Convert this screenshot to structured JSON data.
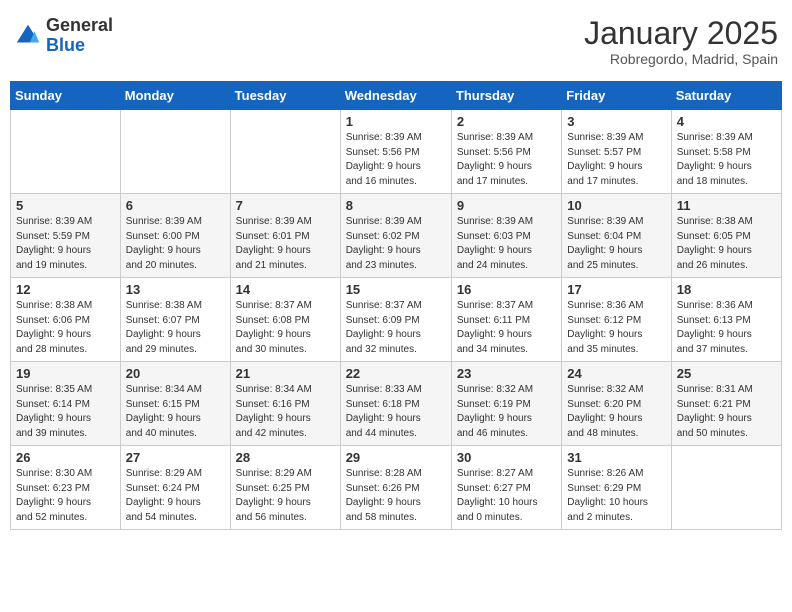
{
  "header": {
    "logo_general": "General",
    "logo_blue": "Blue",
    "month_title": "January 2025",
    "location": "Robregordo, Madrid, Spain"
  },
  "weekdays": [
    "Sunday",
    "Monday",
    "Tuesday",
    "Wednesday",
    "Thursday",
    "Friday",
    "Saturday"
  ],
  "weeks": [
    [
      {
        "day": "",
        "info": ""
      },
      {
        "day": "",
        "info": ""
      },
      {
        "day": "",
        "info": ""
      },
      {
        "day": "1",
        "info": "Sunrise: 8:39 AM\nSunset: 5:56 PM\nDaylight: 9 hours\nand 16 minutes."
      },
      {
        "day": "2",
        "info": "Sunrise: 8:39 AM\nSunset: 5:56 PM\nDaylight: 9 hours\nand 17 minutes."
      },
      {
        "day": "3",
        "info": "Sunrise: 8:39 AM\nSunset: 5:57 PM\nDaylight: 9 hours\nand 17 minutes."
      },
      {
        "day": "4",
        "info": "Sunrise: 8:39 AM\nSunset: 5:58 PM\nDaylight: 9 hours\nand 18 minutes."
      }
    ],
    [
      {
        "day": "5",
        "info": "Sunrise: 8:39 AM\nSunset: 5:59 PM\nDaylight: 9 hours\nand 19 minutes."
      },
      {
        "day": "6",
        "info": "Sunrise: 8:39 AM\nSunset: 6:00 PM\nDaylight: 9 hours\nand 20 minutes."
      },
      {
        "day": "7",
        "info": "Sunrise: 8:39 AM\nSunset: 6:01 PM\nDaylight: 9 hours\nand 21 minutes."
      },
      {
        "day": "8",
        "info": "Sunrise: 8:39 AM\nSunset: 6:02 PM\nDaylight: 9 hours\nand 23 minutes."
      },
      {
        "day": "9",
        "info": "Sunrise: 8:39 AM\nSunset: 6:03 PM\nDaylight: 9 hours\nand 24 minutes."
      },
      {
        "day": "10",
        "info": "Sunrise: 8:39 AM\nSunset: 6:04 PM\nDaylight: 9 hours\nand 25 minutes."
      },
      {
        "day": "11",
        "info": "Sunrise: 8:38 AM\nSunset: 6:05 PM\nDaylight: 9 hours\nand 26 minutes."
      }
    ],
    [
      {
        "day": "12",
        "info": "Sunrise: 8:38 AM\nSunset: 6:06 PM\nDaylight: 9 hours\nand 28 minutes."
      },
      {
        "day": "13",
        "info": "Sunrise: 8:38 AM\nSunset: 6:07 PM\nDaylight: 9 hours\nand 29 minutes."
      },
      {
        "day": "14",
        "info": "Sunrise: 8:37 AM\nSunset: 6:08 PM\nDaylight: 9 hours\nand 30 minutes."
      },
      {
        "day": "15",
        "info": "Sunrise: 8:37 AM\nSunset: 6:09 PM\nDaylight: 9 hours\nand 32 minutes."
      },
      {
        "day": "16",
        "info": "Sunrise: 8:37 AM\nSunset: 6:11 PM\nDaylight: 9 hours\nand 34 minutes."
      },
      {
        "day": "17",
        "info": "Sunrise: 8:36 AM\nSunset: 6:12 PM\nDaylight: 9 hours\nand 35 minutes."
      },
      {
        "day": "18",
        "info": "Sunrise: 8:36 AM\nSunset: 6:13 PM\nDaylight: 9 hours\nand 37 minutes."
      }
    ],
    [
      {
        "day": "19",
        "info": "Sunrise: 8:35 AM\nSunset: 6:14 PM\nDaylight: 9 hours\nand 39 minutes."
      },
      {
        "day": "20",
        "info": "Sunrise: 8:34 AM\nSunset: 6:15 PM\nDaylight: 9 hours\nand 40 minutes."
      },
      {
        "day": "21",
        "info": "Sunrise: 8:34 AM\nSunset: 6:16 PM\nDaylight: 9 hours\nand 42 minutes."
      },
      {
        "day": "22",
        "info": "Sunrise: 8:33 AM\nSunset: 6:18 PM\nDaylight: 9 hours\nand 44 minutes."
      },
      {
        "day": "23",
        "info": "Sunrise: 8:32 AM\nSunset: 6:19 PM\nDaylight: 9 hours\nand 46 minutes."
      },
      {
        "day": "24",
        "info": "Sunrise: 8:32 AM\nSunset: 6:20 PM\nDaylight: 9 hours\nand 48 minutes."
      },
      {
        "day": "25",
        "info": "Sunrise: 8:31 AM\nSunset: 6:21 PM\nDaylight: 9 hours\nand 50 minutes."
      }
    ],
    [
      {
        "day": "26",
        "info": "Sunrise: 8:30 AM\nSunset: 6:23 PM\nDaylight: 9 hours\nand 52 minutes."
      },
      {
        "day": "27",
        "info": "Sunrise: 8:29 AM\nSunset: 6:24 PM\nDaylight: 9 hours\nand 54 minutes."
      },
      {
        "day": "28",
        "info": "Sunrise: 8:29 AM\nSunset: 6:25 PM\nDaylight: 9 hours\nand 56 minutes."
      },
      {
        "day": "29",
        "info": "Sunrise: 8:28 AM\nSunset: 6:26 PM\nDaylight: 9 hours\nand 58 minutes."
      },
      {
        "day": "30",
        "info": "Sunrise: 8:27 AM\nSunset: 6:27 PM\nDaylight: 10 hours\nand 0 minutes."
      },
      {
        "day": "31",
        "info": "Sunrise: 8:26 AM\nSunset: 6:29 PM\nDaylight: 10 hours\nand 2 minutes."
      },
      {
        "day": "",
        "info": ""
      }
    ]
  ]
}
